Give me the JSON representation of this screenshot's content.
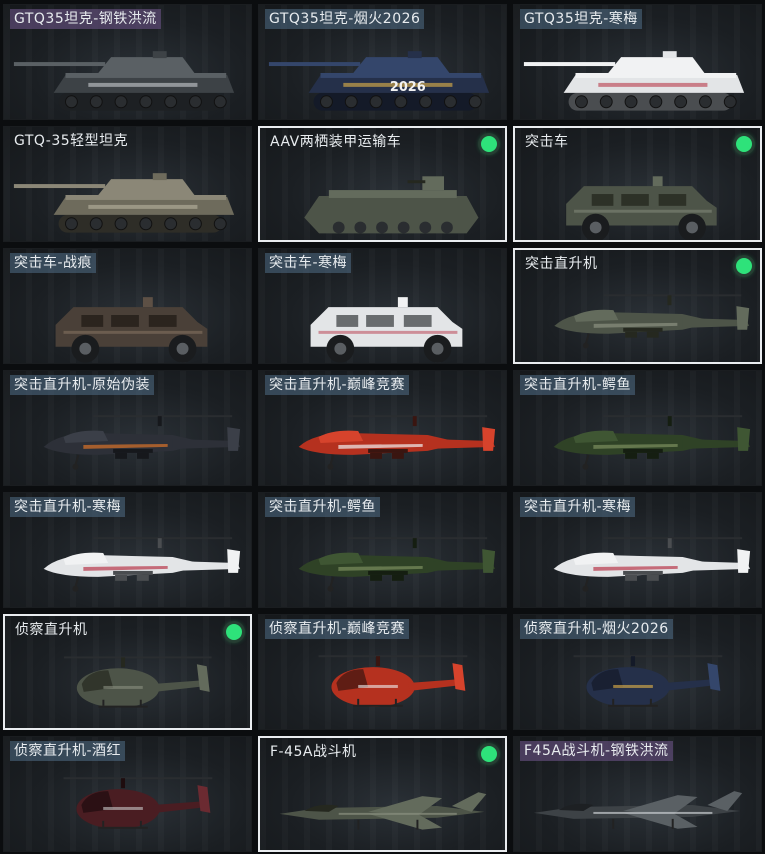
{
  "colors": {
    "equipped_dot": "#2ee27a",
    "selected_border": "#e9ecef",
    "label_blue": "#506e87",
    "label_purple": "#5f4b78"
  },
  "items": [
    {
      "name": "GTQ35坦克-钢铁洪流",
      "kind": "tank",
      "skin": "steel",
      "tag": "purple",
      "selected": false,
      "equipped": false
    },
    {
      "name": "GTQ35坦克-烟火2026",
      "kind": "tank",
      "skin": "firework",
      "tag": "blue",
      "selected": false,
      "equipped": false,
      "decal": "2026"
    },
    {
      "name": "GTQ35坦克-寒梅",
      "kind": "tank",
      "skin": "plum",
      "tag": "blue",
      "selected": false,
      "equipped": false
    },
    {
      "name": "GTQ-35轻型坦克",
      "kind": "tank",
      "skin": "camo",
      "tag": "none",
      "selected": false,
      "equipped": false
    },
    {
      "name": "AAV两栖装甲运输车",
      "kind": "aav",
      "skin": "default",
      "tag": "none",
      "selected": true,
      "equipped": true
    },
    {
      "name": "突击车",
      "kind": "truck",
      "skin": "default",
      "tag": "none",
      "selected": true,
      "equipped": true
    },
    {
      "name": "突击车-战痕",
      "kind": "truck",
      "skin": "rust",
      "tag": "blue",
      "selected": false,
      "equipped": false
    },
    {
      "name": "突击车-寒梅",
      "kind": "truck",
      "skin": "plum",
      "tag": "blue",
      "selected": false,
      "equipped": false
    },
    {
      "name": "突击直升机",
      "kind": "apache",
      "skin": "default",
      "tag": "none",
      "selected": true,
      "equipped": true
    },
    {
      "name": "突击直升机-原始伪装",
      "kind": "apache",
      "skin": "orange",
      "tag": "blue",
      "selected": false,
      "equipped": false
    },
    {
      "name": "突击直升机-巅峰竞赛",
      "kind": "apache",
      "skin": "red",
      "tag": "blue",
      "selected": false,
      "equipped": false
    },
    {
      "name": "突击直升机-鳄鱼",
      "kind": "apache",
      "skin": "green",
      "tag": "blue",
      "selected": false,
      "equipped": false
    },
    {
      "name": "突击直升机-寒梅",
      "kind": "apache",
      "skin": "plum",
      "tag": "blue",
      "selected": false,
      "equipped": false
    },
    {
      "name": "突击直升机-鳄鱼",
      "kind": "apache",
      "skin": "green",
      "tag": "blue",
      "selected": false,
      "equipped": false
    },
    {
      "name": "突击直升机-寒梅",
      "kind": "apache",
      "skin": "plum",
      "tag": "blue",
      "selected": false,
      "equipped": false
    },
    {
      "name": "侦察直升机",
      "kind": "scout",
      "skin": "default",
      "tag": "none",
      "selected": true,
      "equipped": true
    },
    {
      "name": "侦察直升机-巅峰竞赛",
      "kind": "scout",
      "skin": "red",
      "tag": "blue",
      "selected": false,
      "equipped": false
    },
    {
      "name": "侦察直升机-烟火2026",
      "kind": "scout",
      "skin": "firework",
      "tag": "blue",
      "selected": false,
      "equipped": false
    },
    {
      "name": "侦察直升机-酒红",
      "kind": "scout",
      "skin": "wine",
      "tag": "blue",
      "selected": false,
      "equipped": false
    },
    {
      "name": "F-45A战斗机",
      "kind": "jet",
      "skin": "default",
      "tag": "none",
      "selected": true,
      "equipped": true
    },
    {
      "name": "F45A战斗机-钢铁洪流",
      "kind": "jet",
      "skin": "steel",
      "tag": "purple",
      "selected": false,
      "equipped": false
    }
  ]
}
